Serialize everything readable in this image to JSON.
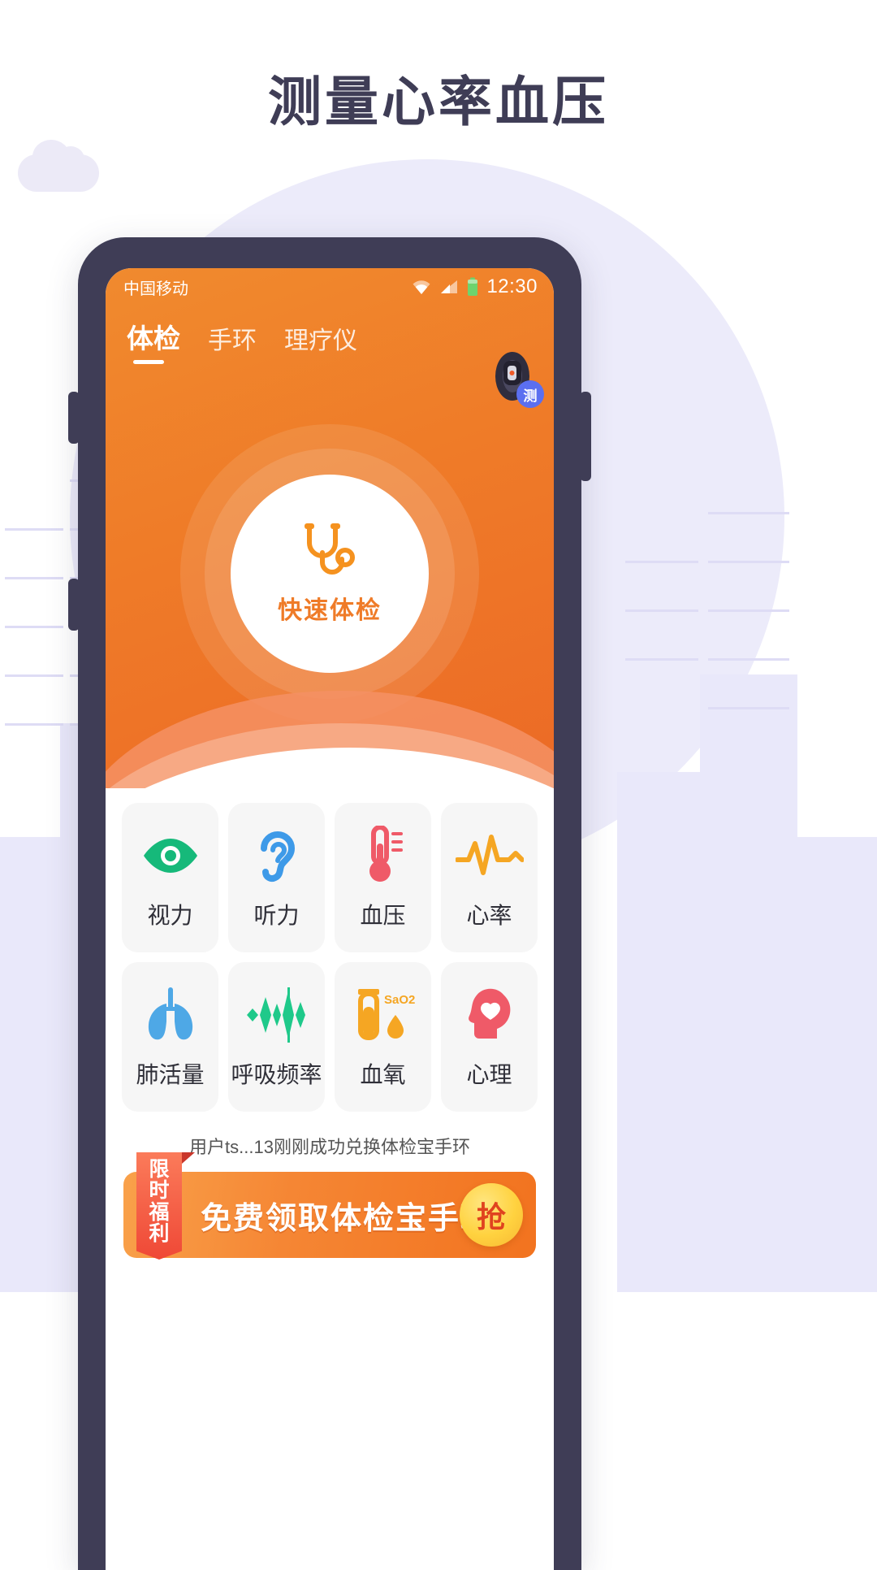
{
  "page": {
    "headline": "测量心率血压",
    "background_color": "#ffffff",
    "accent_color": "#ef7b28",
    "dark_color": "#3f3d56"
  },
  "phone": {
    "statusbar": {
      "carrier": "中国移动",
      "wifi_icon": "wifi-icon",
      "signal_icon": "signal-icon",
      "battery_icon": "battery-icon",
      "battery_color": "#6ed36e",
      "time": "12:30"
    },
    "tabs": [
      {
        "label": "体检",
        "active": true
      },
      {
        "label": "手环",
        "active": false
      },
      {
        "label": "理疗仪",
        "active": false
      }
    ],
    "band_badge": {
      "icon": "wristband-icon",
      "badge_label": "测",
      "badge_color": "#5b6ff0"
    },
    "hero": {
      "icon": "stethoscope-icon",
      "label": "快速体检",
      "label_color": "#ef7b28"
    },
    "grid": [
      {
        "label": "视力",
        "icon": "eye-icon",
        "color": "#16b97a"
      },
      {
        "label": "听力",
        "icon": "ear-icon",
        "color": "#3e9ae8"
      },
      {
        "label": "血压",
        "icon": "thermometer-icon",
        "color": "#ef5a68"
      },
      {
        "label": "心率",
        "icon": "heartbeat-icon",
        "color": "#f5a623"
      },
      {
        "label": "肺活量",
        "icon": "lungs-icon",
        "color": "#4ea8e6"
      },
      {
        "label": "呼吸频率",
        "icon": "waveform-icon",
        "color": "#1fc98a"
      },
      {
        "label": "血氧",
        "icon": "test-tube-icon",
        "color": "#f5a623",
        "sublabel": "SaO2"
      },
      {
        "label": "心理",
        "icon": "head-heart-icon",
        "color": "#ef5a68"
      }
    ],
    "notice": "用户ts...13刚刚成功兑换体检宝手环",
    "promo": {
      "ribbon": "限时福利",
      "title": "免费领取体检宝手环",
      "button_label": "抢"
    }
  }
}
